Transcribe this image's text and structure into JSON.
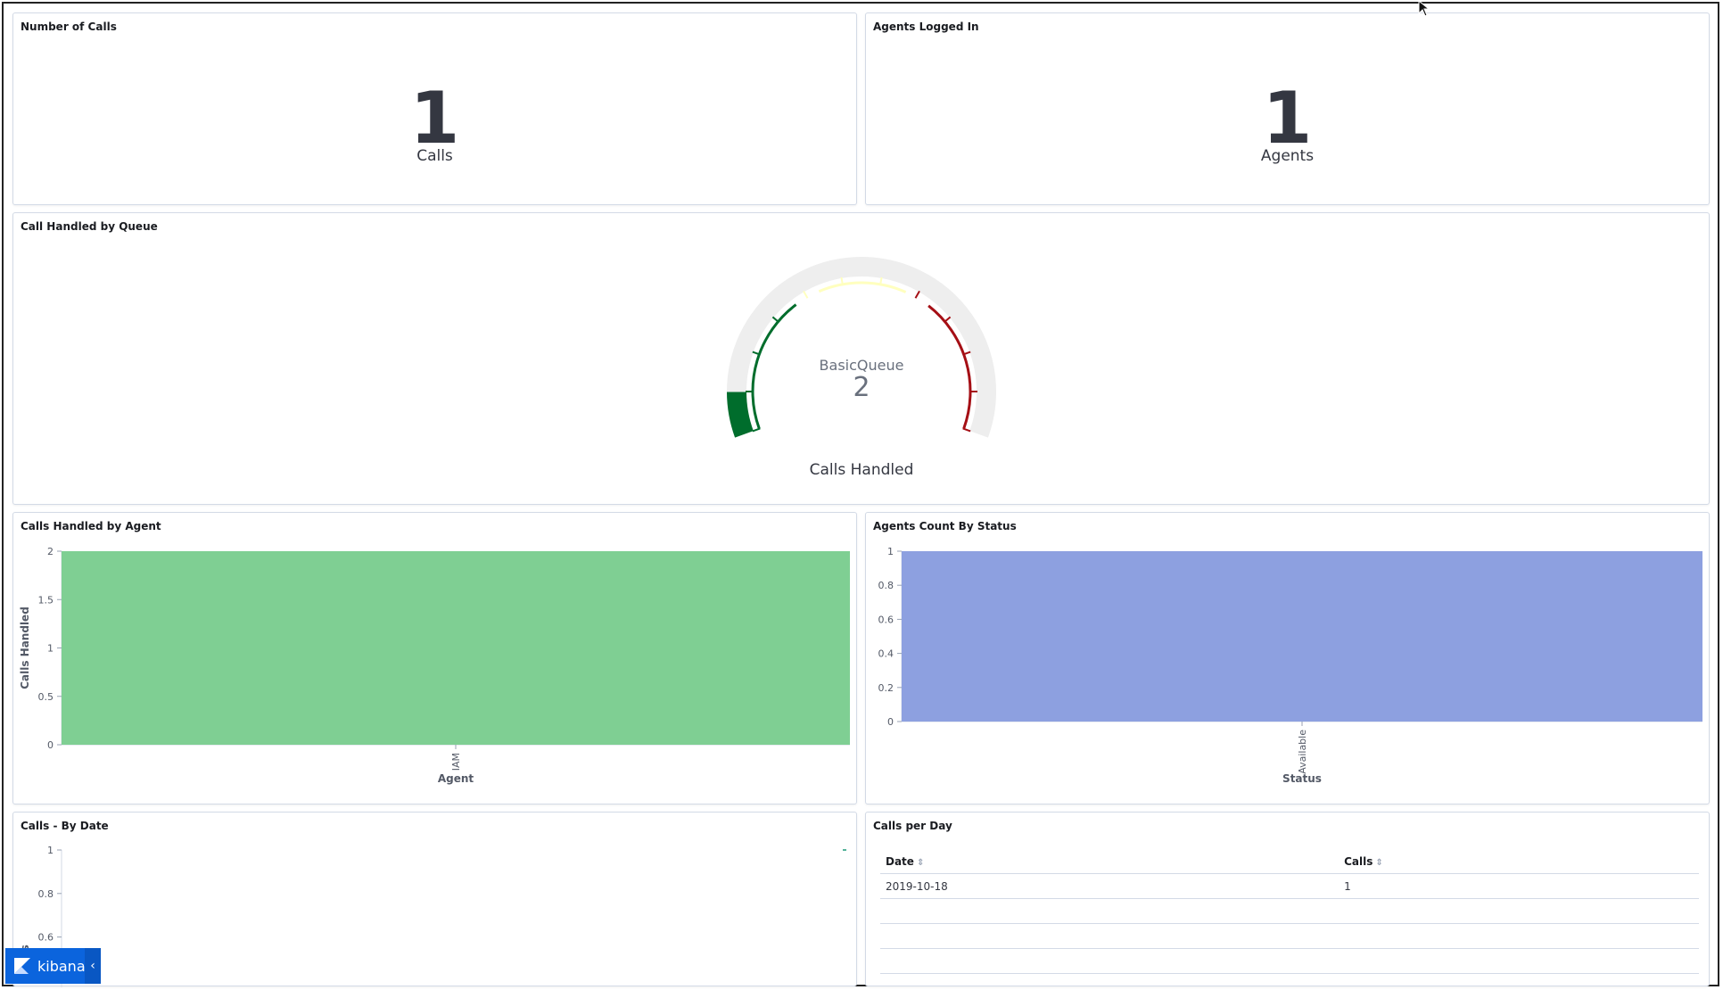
{
  "colors": {
    "accent": "#0b64dd",
    "green_bar": "#7fcf93",
    "blue_bar": "#8da0e0",
    "gauge_green": "#006d2c",
    "gauge_red": "#a50f15"
  },
  "panels": {
    "number_of_calls": {
      "title": "Number of Calls",
      "value": "1",
      "label": "Calls"
    },
    "agents_logged_in": {
      "title": "Agents Logged In",
      "value": "1",
      "label": "Agents"
    },
    "queue_gauge": {
      "title": "Call Handled by Queue",
      "queue_name": "BasicQueue",
      "value": "2",
      "label": "Calls Handled"
    },
    "calls_by_agent": {
      "title": "Calls Handled by Agent"
    },
    "agents_by_status": {
      "title": "Agents Count By Status"
    },
    "calls_by_date": {
      "title": "Calls - By Date"
    },
    "calls_per_day": {
      "title": "Calls per Day",
      "columns": [
        "Date",
        "Calls"
      ],
      "rows": [
        [
          "2019-10-18",
          "1"
        ]
      ]
    }
  },
  "kibana": {
    "label": "kibana",
    "toggle_icon": "chevron-left-icon"
  },
  "chart_data": [
    {
      "type": "gauge",
      "title": "Call Handled by Queue",
      "label": "Calls Handled",
      "series": [
        {
          "name": "BasicQueue",
          "values": [
            2
          ]
        }
      ],
      "ranges_colors": [
        "green",
        "yellow",
        "red"
      ]
    },
    {
      "type": "bar",
      "title": "Calls Handled by Agent",
      "categories": [
        "IAM"
      ],
      "values": [
        2
      ],
      "xlabel": "Agent",
      "ylabel": "Calls Handled",
      "ylim": [
        0,
        2
      ],
      "yticks": [
        "0",
        "0.5",
        "1",
        "1.5",
        "2"
      ]
    },
    {
      "type": "bar",
      "title": "Agents Count By Status",
      "categories": [
        "Available"
      ],
      "values": [
        1
      ],
      "xlabel": "Status",
      "ylabel": "",
      "ylim": [
        0,
        1
      ],
      "yticks": [
        "0",
        "0.2",
        "0.4",
        "0.6",
        "0.8",
        "1"
      ]
    },
    {
      "type": "line",
      "title": "Calls - By Date",
      "ylabel": "alls",
      "ylim": [
        0,
        1
      ],
      "yticks": [
        "0.6",
        "0.8",
        "1"
      ]
    }
  ]
}
